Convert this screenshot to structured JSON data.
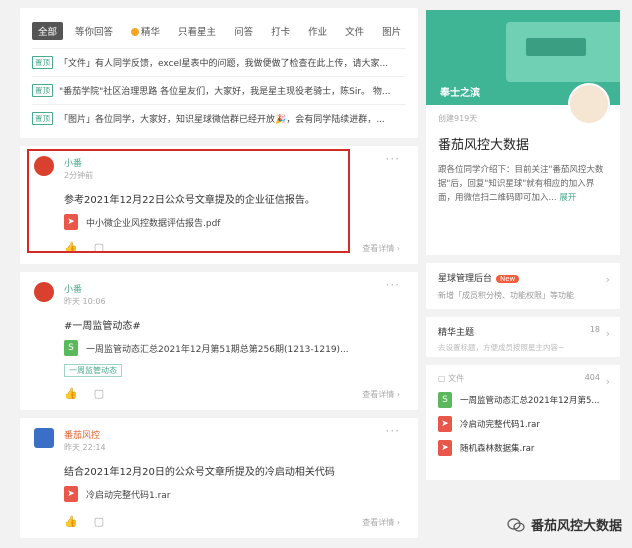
{
  "tabs": [
    "全部",
    "等你回答",
    "精华",
    "只看星主",
    "问答",
    "打卡",
    "作业",
    "文件",
    "图片"
  ],
  "pinned_tag": "置顶",
  "pinned": [
    "「文件」有人同学反馈，excel星表中的问题，我做便做了检查在此上传，请大家...",
    "\"番茄学院\"社区治理思路 各位星友们，大家好，我是星主现役老骑士，陈Sir。 物...",
    "「图片」各位同学，大家好，知识星球微信群已经开放🎉，会有同学陆续进群，..."
  ],
  "posts": [
    {
      "author": "小番",
      "time": "2分钟前",
      "content": "参考2021年12月22日公众号文章提及的企业征信报告。",
      "attachment": "中小微企业风控数据评估报告.pdf",
      "detail": "查看详情 ›"
    },
    {
      "author": "小番",
      "time": "昨天 10:06",
      "content": "#一周监管动态#",
      "attachment": "一周监管动态汇总2021年12月第51期总第256期(1213-1219)...",
      "topic": "一周监管动态",
      "detail": "查看详情 ›"
    },
    {
      "author": "番茄风控",
      "time": "昨天 22:14",
      "content": "结合2021年12月20日的公众号文章所提及的冷启动相关代码",
      "attachment": "冷启动完整代码1.rar",
      "detail": "查看详情 ›"
    }
  ],
  "planet": {
    "banner_name": "奉士之滨",
    "days": "创建919天",
    "title": "番茄风控大数据",
    "desc": "跟各位同学介绍下：目前关注\"番茄风控大数据\"后，回复\"知识星球\"就有相应的加入界面，用微信扫二维码即可加入...",
    "unfold": "展开"
  },
  "mgmt": {
    "title": "星球管理后台",
    "badge": "New",
    "sub": "新增「成员积分榜、功能权限」等功能"
  },
  "essence": {
    "title": "精华主题",
    "count": "18",
    "sub": "去设置标题，方便成员按照星主内容~"
  },
  "files": {
    "header": "文件",
    "count": "404",
    "items": [
      {
        "name": "一周监管动态汇总2021年12月第5..."
      },
      {
        "name": "冷启动完整代码1.rar"
      },
      {
        "name": "随机森林数据集.rar"
      }
    ]
  },
  "watermark": "番茄风控大数据",
  "colors": {
    "accent": "#4aab8c",
    "highlight": "#d32b26",
    "banner": "#3fb596"
  }
}
